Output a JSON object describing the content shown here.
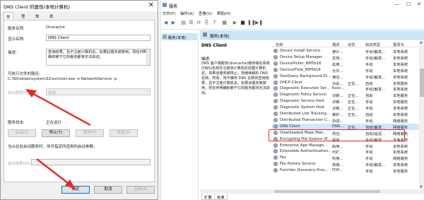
{
  "dialog": {
    "title": "DNS Client 的属性(本地计算机)",
    "tabs": [
      "常规",
      "登录",
      "恢复",
      "依存关系"
    ],
    "fields": {
      "service_name_label": "服务名称:",
      "service_name_value": "Dnscache",
      "display_name_label": "显示名称:",
      "display_name_value": "DNS Client",
      "description_label": "描述:",
      "description_text": "查询结果，且不注册计算机名。如果此服务被禁用，则任何明确依赖于它的服务都将无法启动。",
      "exe_path_label": "可执行文件的路径:",
      "exe_path_value": "C:\\Windows\\system32\\svchost.exe -k NetworkService -p",
      "startup_type_label": "启动类型(E):",
      "startup_type_value": "自动",
      "service_status_label": "服务状态:",
      "service_status_value": "正在运行",
      "start_params_hint": "当从此处启动服务时，你可指定所适用的启动参数。",
      "start_params_label": "启动参数(M):"
    },
    "service_buttons": [
      "启动(S)",
      "停止(T)",
      "暂停(P)",
      "恢复(R)"
    ],
    "footer_buttons": {
      "ok": "确定",
      "cancel": "取消",
      "apply": "应用(A)"
    }
  },
  "services_window": {
    "title": "服务",
    "menu": [
      "文件(F)",
      "操作(A)",
      "查看(V)",
      "帮助(H)"
    ],
    "tree_node": "服务(本地)",
    "header_title": "服务(本地)",
    "selected_name": "DNS Client",
    "desc_label": "描述:",
    "desc_text": "DNS 客户端服务(dnscache)缓存域名系统(DNS)名称并注册该计算机的完整计算机名。如果该服务被停止，将继续解析 DNS 名称。然而，将不缓存 DNS 名称的查询结果，且不注册计算机名。如果该服务被禁用，则任何明确依赖于它的服务都将无法启动。",
    "columns": [
      "名称",
      "描述",
      "状态",
      "启动类型",
      "登录为"
    ],
    "rows": [
      {
        "name": "Device Install Service",
        "desc": "使计...",
        "status": "",
        "startup": "手动(触发...",
        "logon": "本地系统"
      },
      {
        "name": "Device Setup Manager",
        "desc": "支持...",
        "status": "",
        "startup": "手动(触发...",
        "logon": "本地系统"
      },
      {
        "name": "DevicePicker_89f5b16",
        "desc": "此用...",
        "status": "",
        "startup": "手动",
        "logon": "本地系统"
      },
      {
        "name": "DevicesFlow_89f5b16",
        "desc": "允许...",
        "status": "",
        "startup": "手动",
        "logon": "本地系统"
      },
      {
        "name": "DevQuery Background Di...",
        "desc": "使应...",
        "status": "",
        "startup": "手动(触发...",
        "logon": "本地系统"
      },
      {
        "name": "DHCP Client",
        "desc": "为此...",
        "status": "正在...",
        "startup": "自动",
        "logon": "本地服务"
      },
      {
        "name": "Diagnostic Execution Ser...",
        "desc": "Exec...",
        "status": "",
        "startup": "手动(触发...",
        "logon": "本地系统"
      },
      {
        "name": "Diagnostic Policy Service",
        "desc": "诊断...",
        "status": "正在...",
        "startup": "自动",
        "logon": "本地服务"
      },
      {
        "name": "Diagnostic Service Host",
        "desc": "诊断...",
        "status": "正在...",
        "startup": "手动",
        "logon": "本地服务"
      },
      {
        "name": "Diagnostic System Host",
        "desc": "诊断...",
        "status": "正在...",
        "startup": "手动",
        "logon": "本地系统"
      },
      {
        "name": "Distributed Link Tracking...",
        "desc": "维护...",
        "status": "正在...",
        "startup": "自动",
        "logon": "本地系统"
      },
      {
        "name": "Distributed Transaction C...",
        "desc": "协调...",
        "status": "",
        "startup": "手动",
        "logon": "网络服务"
      },
      {
        "name": "DNS Client",
        "desc": "DNS...",
        "status": "正在...",
        "startup": "自动(触发...",
        "logon": "网络服务"
      },
      {
        "name": "Downloaded Maps Man...",
        "desc": "供应...",
        "status": "",
        "startup": "自动(延迟...",
        "logon": "网络服务"
      },
      {
        "name": "Encrypting File System (E...",
        "desc": "提供...",
        "status": "",
        "startup": "手动(触发...",
        "logon": "本地系统"
      },
      {
        "name": "Enterprise App Manage...",
        "desc": "启用...",
        "status": "",
        "startup": "手动",
        "logon": "本地系统"
      },
      {
        "name": "Extensible Authentication...",
        "desc": "可扩...",
        "status": "",
        "startup": "手动",
        "logon": "本地系统"
      },
      {
        "name": "Fax",
        "desc": "利用...",
        "status": "",
        "startup": "手动",
        "logon": "网络服务"
      },
      {
        "name": "File History Service",
        "desc": "将用...",
        "status": "",
        "startup": "手动(触发...",
        "logon": "本地系统"
      },
      {
        "name": "Function Discovery Prov...",
        "desc": "FDP...",
        "status": "",
        "startup": "手动",
        "logon": "本地服务"
      }
    ],
    "bottom_tabs": [
      "扩展",
      "标准"
    ]
  },
  "colors": {
    "annotation": "#e52a20",
    "selection": "#cce8ff",
    "header_blue": "#cde6f7"
  }
}
